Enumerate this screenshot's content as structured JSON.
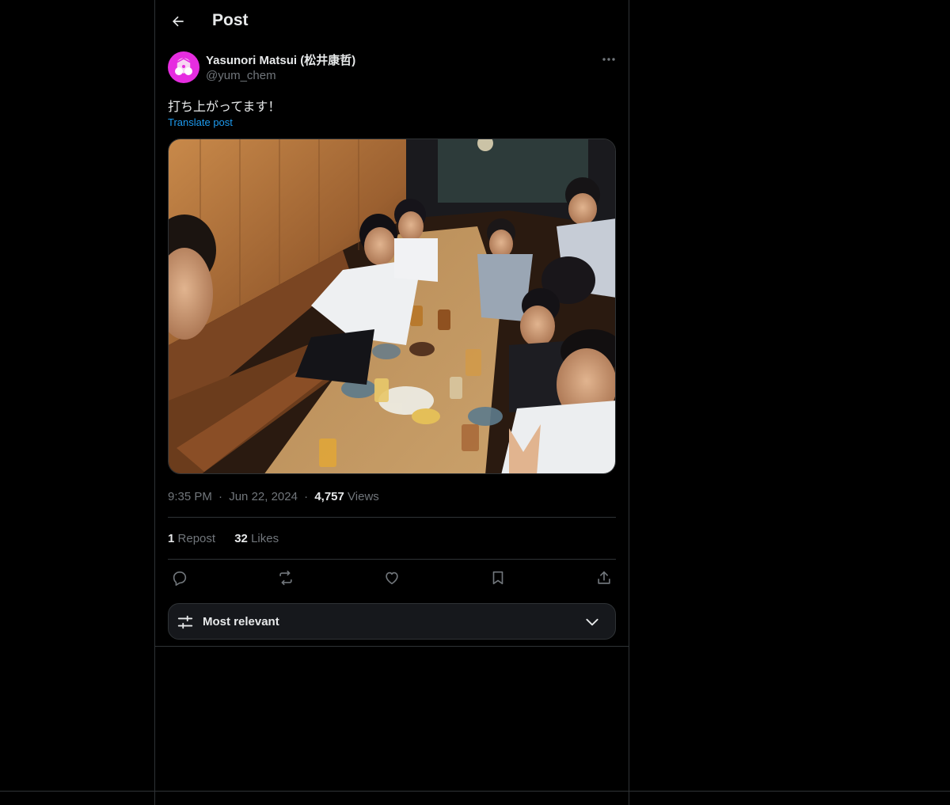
{
  "header": {
    "title": "Post",
    "back_icon": "arrow-left-icon"
  },
  "author": {
    "display_name": "Yasunori Matsui (松井康哲)",
    "handle": "@yum_chem",
    "avatar_colors": [
      "#e62de0",
      "#f7d6f2"
    ]
  },
  "post": {
    "text": "打ち上がってます！",
    "translate_label": "Translate post",
    "photo_subject": "group dinner in a wood-panelled izakaya"
  },
  "meta": {
    "time": "9:35 PM",
    "separator": "·",
    "date": "Jun 22, 2024",
    "views_count": "4,757",
    "views_label": "Views"
  },
  "stats": {
    "reposts_count": "1",
    "reposts_label": "Repost",
    "likes_count": "32",
    "likes_label": "Likes"
  },
  "actions": [
    "reply-icon",
    "repost-icon",
    "like-icon",
    "bookmark-icon",
    "share-icon"
  ],
  "replies_sort": {
    "label": "Most relevant",
    "icon": "sliders-icon",
    "chevron": "chevron-down-icon"
  },
  "colors": {
    "background": "#000000",
    "text": "#e7e9ea",
    "muted": "#71767b",
    "accent": "#1d9bf0",
    "border": "#2f3336",
    "sort_bar_bg": "#16181c"
  }
}
